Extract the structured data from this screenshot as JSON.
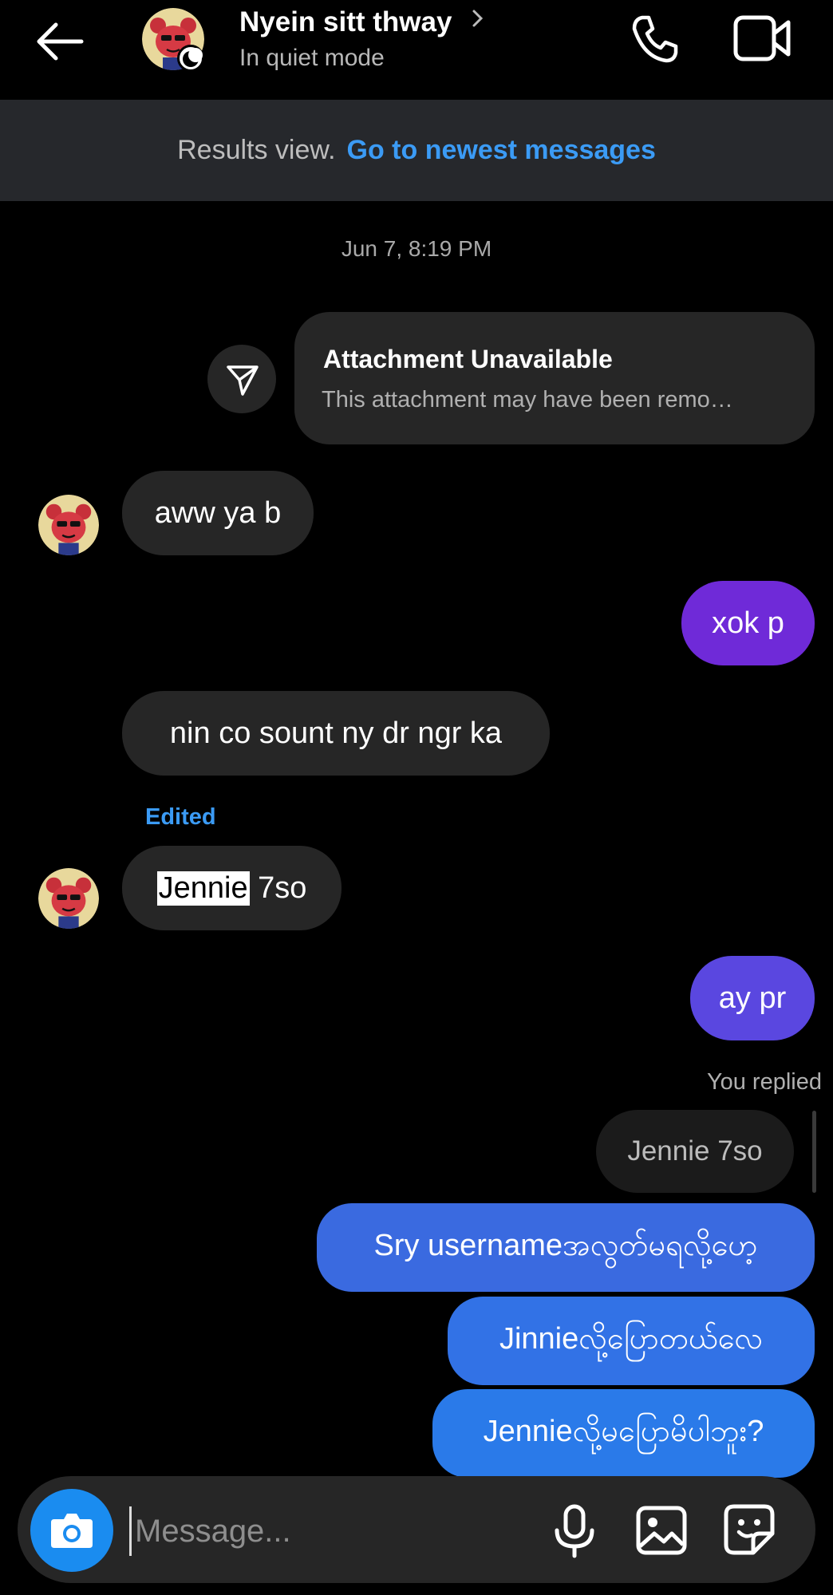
{
  "header": {
    "contact_name": "Nyein sitt thway",
    "status": "In quiet mode",
    "icons": [
      "back-arrow-icon",
      "chevron-right-icon",
      "phone-icon",
      "video-camera-icon",
      "moon-icon"
    ]
  },
  "banner": {
    "text": "Results view.",
    "link": "Go to newest messages"
  },
  "thread": {
    "timestamp": "Jun 7, 8:19 PM",
    "attachment": {
      "title": "Attachment Unavailable",
      "subtitle": "This attachment may have been remo…"
    },
    "messages": [
      {
        "from": "them",
        "text": "aww ya b"
      },
      {
        "from": "me",
        "text": "xok p"
      },
      {
        "from": "them",
        "text": "nin co sount ny dr ngr ka"
      },
      {
        "from": "them",
        "edited_label": "Edited",
        "highlight": "Jennie",
        "rest": " 7so"
      },
      {
        "from": "me",
        "text": "ay pr"
      }
    ],
    "reply": {
      "label": "You replied",
      "quoted": "Jennie 7so"
    },
    "sent_messages": [
      "Sry usernameအလွတ်မရလို့ဟေ့",
      "Jinnieလို့ပြောတယ်လေ",
      "Jennieလို့မပြောမိပါဘူး?"
    ]
  },
  "composer": {
    "placeholder": "Message...",
    "icons": [
      "camera-icon",
      "microphone-icon",
      "gallery-icon",
      "sticker-icon"
    ]
  },
  "colors": {
    "background": "#000000",
    "banner": "#26282c",
    "link": "#3b9bf5",
    "incoming": "#262626",
    "outgoing_purple": "#6f2ad8",
    "outgoing_indigo": "#5a47e0",
    "outgoing_blue": "#2a7ae9",
    "camera": "#1a8cf0"
  }
}
